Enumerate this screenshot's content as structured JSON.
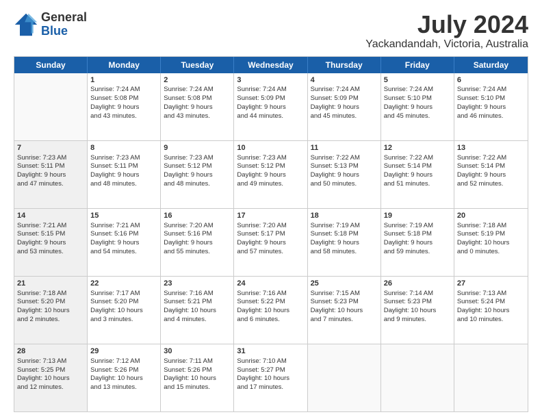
{
  "logo": {
    "general": "General",
    "blue": "Blue"
  },
  "title": "July 2024",
  "subtitle": "Yackandandah, Victoria, Australia",
  "header_days": [
    "Sunday",
    "Monday",
    "Tuesday",
    "Wednesday",
    "Thursday",
    "Friday",
    "Saturday"
  ],
  "weeks": [
    [
      {
        "day": "",
        "empty": true,
        "shaded": false
      },
      {
        "day": "1",
        "lines": [
          "Sunrise: 7:24 AM",
          "Sunset: 5:08 PM",
          "Daylight: 9 hours",
          "and 43 minutes."
        ]
      },
      {
        "day": "2",
        "lines": [
          "Sunrise: 7:24 AM",
          "Sunset: 5:08 PM",
          "Daylight: 9 hours",
          "and 43 minutes."
        ]
      },
      {
        "day": "3",
        "lines": [
          "Sunrise: 7:24 AM",
          "Sunset: 5:09 PM",
          "Daylight: 9 hours",
          "and 44 minutes."
        ]
      },
      {
        "day": "4",
        "lines": [
          "Sunrise: 7:24 AM",
          "Sunset: 5:09 PM",
          "Daylight: 9 hours",
          "and 45 minutes."
        ]
      },
      {
        "day": "5",
        "lines": [
          "Sunrise: 7:24 AM",
          "Sunset: 5:10 PM",
          "Daylight: 9 hours",
          "and 45 minutes."
        ]
      },
      {
        "day": "6",
        "lines": [
          "Sunrise: 7:24 AM",
          "Sunset: 5:10 PM",
          "Daylight: 9 hours",
          "and 46 minutes."
        ]
      }
    ],
    [
      {
        "day": "7",
        "lines": [
          "Sunrise: 7:23 AM",
          "Sunset: 5:11 PM",
          "Daylight: 9 hours",
          "and 47 minutes."
        ],
        "shaded": true
      },
      {
        "day": "8",
        "lines": [
          "Sunrise: 7:23 AM",
          "Sunset: 5:11 PM",
          "Daylight: 9 hours",
          "and 48 minutes."
        ]
      },
      {
        "day": "9",
        "lines": [
          "Sunrise: 7:23 AM",
          "Sunset: 5:12 PM",
          "Daylight: 9 hours",
          "and 48 minutes."
        ]
      },
      {
        "day": "10",
        "lines": [
          "Sunrise: 7:23 AM",
          "Sunset: 5:12 PM",
          "Daylight: 9 hours",
          "and 49 minutes."
        ]
      },
      {
        "day": "11",
        "lines": [
          "Sunrise: 7:22 AM",
          "Sunset: 5:13 PM",
          "Daylight: 9 hours",
          "and 50 minutes."
        ]
      },
      {
        "day": "12",
        "lines": [
          "Sunrise: 7:22 AM",
          "Sunset: 5:14 PM",
          "Daylight: 9 hours",
          "and 51 minutes."
        ]
      },
      {
        "day": "13",
        "lines": [
          "Sunrise: 7:22 AM",
          "Sunset: 5:14 PM",
          "Daylight: 9 hours",
          "and 52 minutes."
        ]
      }
    ],
    [
      {
        "day": "14",
        "lines": [
          "Sunrise: 7:21 AM",
          "Sunset: 5:15 PM",
          "Daylight: 9 hours",
          "and 53 minutes."
        ],
        "shaded": true
      },
      {
        "day": "15",
        "lines": [
          "Sunrise: 7:21 AM",
          "Sunset: 5:16 PM",
          "Daylight: 9 hours",
          "and 54 minutes."
        ]
      },
      {
        "day": "16",
        "lines": [
          "Sunrise: 7:20 AM",
          "Sunset: 5:16 PM",
          "Daylight: 9 hours",
          "and 55 minutes."
        ]
      },
      {
        "day": "17",
        "lines": [
          "Sunrise: 7:20 AM",
          "Sunset: 5:17 PM",
          "Daylight: 9 hours",
          "and 57 minutes."
        ]
      },
      {
        "day": "18",
        "lines": [
          "Sunrise: 7:19 AM",
          "Sunset: 5:18 PM",
          "Daylight: 9 hours",
          "and 58 minutes."
        ]
      },
      {
        "day": "19",
        "lines": [
          "Sunrise: 7:19 AM",
          "Sunset: 5:18 PM",
          "Daylight: 9 hours",
          "and 59 minutes."
        ]
      },
      {
        "day": "20",
        "lines": [
          "Sunrise: 7:18 AM",
          "Sunset: 5:19 PM",
          "Daylight: 10 hours",
          "and 0 minutes."
        ]
      }
    ],
    [
      {
        "day": "21",
        "lines": [
          "Sunrise: 7:18 AM",
          "Sunset: 5:20 PM",
          "Daylight: 10 hours",
          "and 2 minutes."
        ],
        "shaded": true
      },
      {
        "day": "22",
        "lines": [
          "Sunrise: 7:17 AM",
          "Sunset: 5:20 PM",
          "Daylight: 10 hours",
          "and 3 minutes."
        ]
      },
      {
        "day": "23",
        "lines": [
          "Sunrise: 7:16 AM",
          "Sunset: 5:21 PM",
          "Daylight: 10 hours",
          "and 4 minutes."
        ]
      },
      {
        "day": "24",
        "lines": [
          "Sunrise: 7:16 AM",
          "Sunset: 5:22 PM",
          "Daylight: 10 hours",
          "and 6 minutes."
        ]
      },
      {
        "day": "25",
        "lines": [
          "Sunrise: 7:15 AM",
          "Sunset: 5:23 PM",
          "Daylight: 10 hours",
          "and 7 minutes."
        ]
      },
      {
        "day": "26",
        "lines": [
          "Sunrise: 7:14 AM",
          "Sunset: 5:23 PM",
          "Daylight: 10 hours",
          "and 9 minutes."
        ]
      },
      {
        "day": "27",
        "lines": [
          "Sunrise: 7:13 AM",
          "Sunset: 5:24 PM",
          "Daylight: 10 hours",
          "and 10 minutes."
        ]
      }
    ],
    [
      {
        "day": "28",
        "lines": [
          "Sunrise: 7:13 AM",
          "Sunset: 5:25 PM",
          "Daylight: 10 hours",
          "and 12 minutes."
        ],
        "shaded": true
      },
      {
        "day": "29",
        "lines": [
          "Sunrise: 7:12 AM",
          "Sunset: 5:26 PM",
          "Daylight: 10 hours",
          "and 13 minutes."
        ]
      },
      {
        "day": "30",
        "lines": [
          "Sunrise: 7:11 AM",
          "Sunset: 5:26 PM",
          "Daylight: 10 hours",
          "and 15 minutes."
        ]
      },
      {
        "day": "31",
        "lines": [
          "Sunrise: 7:10 AM",
          "Sunset: 5:27 PM",
          "Daylight: 10 hours",
          "and 17 minutes."
        ]
      },
      {
        "day": "",
        "empty": true,
        "shaded": false
      },
      {
        "day": "",
        "empty": true,
        "shaded": false
      },
      {
        "day": "",
        "empty": true,
        "shaded": false
      }
    ]
  ]
}
